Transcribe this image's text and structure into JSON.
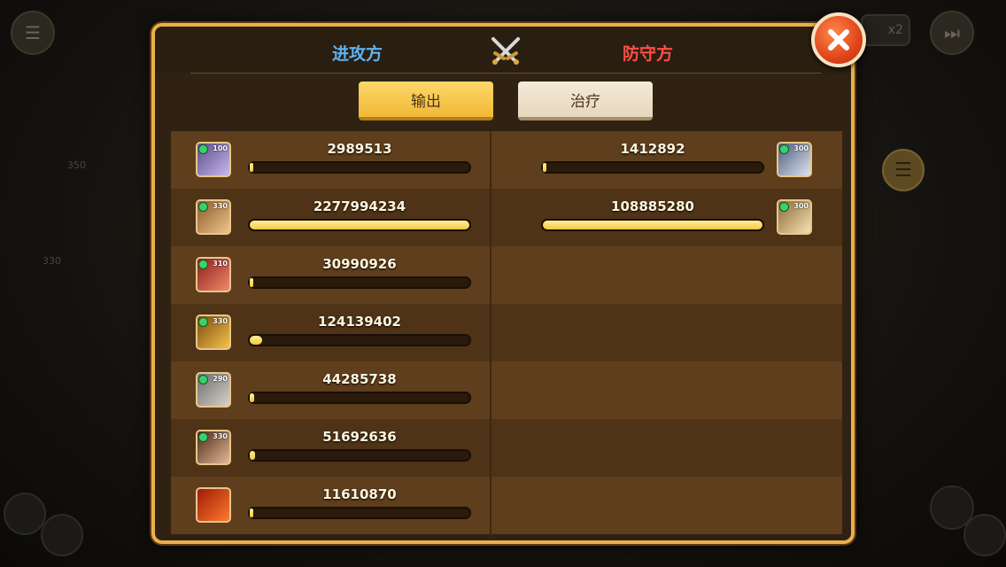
{
  "header": {
    "attacker_title": "进攻方",
    "defender_title": "防守方"
  },
  "tabs": {
    "output": "输出",
    "heal": "治疗"
  },
  "background": {
    "speed_label": "x2",
    "left_nums": [
      "350",
      "330"
    ]
  },
  "attackers": [
    {
      "level": "100",
      "damage": "2989513",
      "fill": 0.013,
      "colors": [
        "#5a4b86",
        "#c8b9ef"
      ]
    },
    {
      "level": "330",
      "damage": "2277994234",
      "fill": 1.0,
      "colors": [
        "#8a5a2c",
        "#f0c48a"
      ]
    },
    {
      "level": "310",
      "damage": "30990926",
      "fill": 0.014,
      "colors": [
        "#8b1d1d",
        "#f08a6a"
      ]
    },
    {
      "level": "330",
      "damage": "124139402",
      "fill": 0.055,
      "colors": [
        "#7a4a10",
        "#f5c34a"
      ]
    },
    {
      "level": "290",
      "damage": "44285738",
      "fill": 0.02,
      "colors": [
        "#6b6b72",
        "#d8d2c4"
      ]
    },
    {
      "level": "330",
      "damage": "51692636",
      "fill": 0.023,
      "colors": [
        "#4a2a1a",
        "#e6b896"
      ]
    },
    {
      "level": "",
      "damage": "11610870",
      "fill": 0.005,
      "colors": [
        "#a01a0a",
        "#ff7a2a"
      ]
    }
  ],
  "defenders": [
    {
      "level": "300",
      "damage": "1412892",
      "fill": 0.013,
      "colors": [
        "#4a5a7a",
        "#dfe6f2"
      ]
    },
    {
      "level": "300",
      "damage": "108885280",
      "fill": 1.0,
      "colors": [
        "#8a6a3a",
        "#f7e3b0"
      ]
    }
  ],
  "colors": {
    "attacker_title": "#5eb3f2",
    "defender_title": "#ff4f45",
    "bar_fill": "#f5c83f",
    "panel_border": "#e9b04b",
    "close_button": "#e0451c"
  },
  "icons": {
    "header_center": "crossed-swords-icon",
    "close": "close-icon",
    "background_menu": "list-menu-icon"
  }
}
